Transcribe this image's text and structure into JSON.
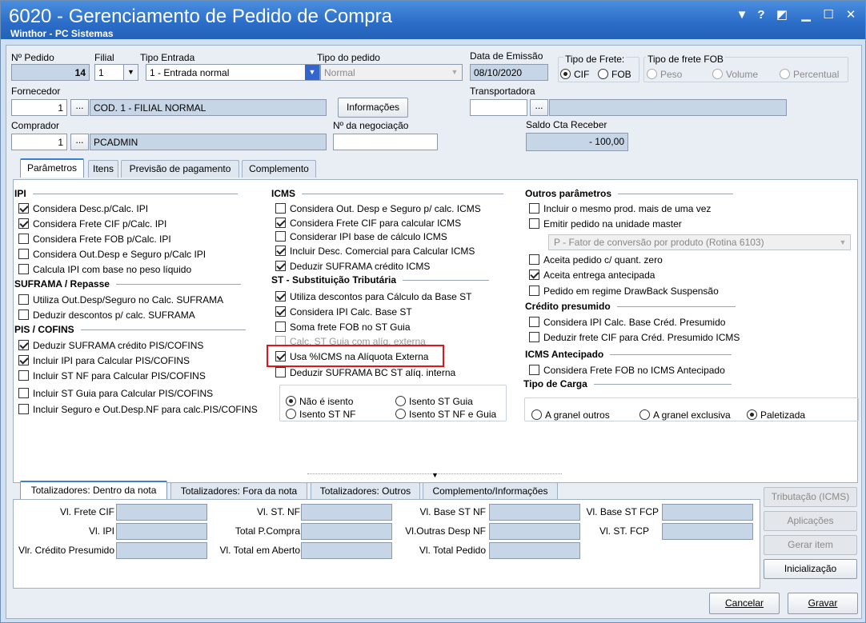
{
  "window": {
    "title": "6020 - Gerenciamento de Pedido de Compra",
    "subtitle": "Winthor - PC Sistemas",
    "buttons": {
      "menu": "▼",
      "help": "?",
      "restore": "◩",
      "minimize": "▁",
      "maximize": "☐",
      "close": "✕"
    }
  },
  "header": {
    "nro_pedido": {
      "label": "Nº Pedido",
      "value": "14"
    },
    "filial": {
      "label": "Filial",
      "value": "1"
    },
    "tipo_entrada": {
      "label": "Tipo Entrada",
      "value": "1 - Entrada normal"
    },
    "tipo_pedido": {
      "label": "Tipo do pedido",
      "value": "Normal"
    },
    "data_emissao": {
      "label": "Data de Emissão",
      "value": "08/10/2020"
    },
    "tipo_frete": {
      "label": "Tipo de Frete:",
      "options": [
        "CIF",
        "FOB"
      ],
      "selected": "CIF"
    },
    "tipo_frete_fob": {
      "label": "Tipo de frete FOB",
      "options": [
        "Peso",
        "Volume",
        "Percentual"
      ]
    },
    "fornecedor": {
      "label": "Fornecedor",
      "code": "1",
      "name": "COD. 1 - FILIAL NORMAL"
    },
    "informacoes_button": "Informações",
    "transportadora": {
      "label": "Transportadora",
      "code": "",
      "name": ""
    },
    "comprador": {
      "label": "Comprador",
      "code": "1",
      "name": "PCADMIN"
    },
    "nro_negociacao": {
      "label": "Nº da negociação",
      "value": ""
    },
    "saldo_cta": {
      "label": "Saldo Cta Receber",
      "value": "- 100,00"
    },
    "ellipsis": "..."
  },
  "tabs": [
    "Parâmetros",
    "Itens",
    "Previsão de pagamento",
    "Complemento"
  ],
  "params": {
    "ipi": {
      "title": "IPI",
      "items": [
        {
          "label": "Considera Desc.p/Calc. IPI",
          "checked": true
        },
        {
          "label": "Considera Frete CIF p/Calc. IPI",
          "checked": true
        },
        {
          "label": "Considera Frete FOB p/Calc. IPI",
          "checked": false
        },
        {
          "label": "Considera Out.Desp e Seguro p/Calc IPI",
          "checked": false
        },
        {
          "label": "Calcula IPI com base no peso líquido",
          "checked": false
        }
      ]
    },
    "suframa": {
      "title": "SUFRAMA / Repasse",
      "items": [
        {
          "label": "Utiliza Out.Desp/Seguro no Calc. SUFRAMA",
          "checked": false
        },
        {
          "label": "Deduzir descontos p/ calc. SUFRAMA",
          "checked": false
        }
      ]
    },
    "pis": {
      "title": "PIS / COFINS",
      "items": [
        {
          "label": "Deduzir SUFRAMA crédito PIS/COFINS",
          "checked": true
        },
        {
          "label": "Incluir IPI para Calcular PIS/COFINS",
          "checked": true
        },
        {
          "label": "Incluir ST NF para Calcular PIS/COFINS",
          "checked": false
        },
        {
          "label": "Incluir ST Guia para Calcular PIS/COFINS",
          "checked": false
        },
        {
          "label": "Incluir Seguro e Out.Desp.NF para calc.PIS/COFINS",
          "checked": false
        }
      ]
    },
    "icms": {
      "title": "ICMS",
      "items": [
        {
          "label": "Considera Out. Desp e Seguro p/ calc. ICMS",
          "checked": false
        },
        {
          "label": "Considera Frete CIF para calcular ICMS",
          "checked": true
        },
        {
          "label": "Considerar IPI base de cálculo ICMS",
          "checked": false
        },
        {
          "label": "Incluir Desc. Comercial  para Calcular ICMS",
          "checked": true
        },
        {
          "label": "Deduzir SUFRAMA crédito ICMS",
          "checked": true
        }
      ]
    },
    "st": {
      "title": "ST - Substituição Tributária",
      "items": [
        {
          "label": "Utiliza descontos para Cálculo da Base ST",
          "checked": true
        },
        {
          "label": "Considera IPI Calc. Base ST",
          "checked": true
        },
        {
          "label": "Soma frete FOB no ST Guia",
          "checked": false
        },
        {
          "label": "Calc. ST Guia com alíq. externa",
          "checked": false,
          "disabled": true
        },
        {
          "label": "Usa %ICMS na Alíquota Externa",
          "checked": true
        },
        {
          "label": "Deduzir SUFRAMA BC ST alíq. interna",
          "checked": false
        }
      ]
    },
    "isencao": {
      "options": [
        "Não é isento",
        "Isento ST Guia",
        "Isento ST NF",
        "Isento ST NF e Guia"
      ],
      "selected": "Não é isento"
    },
    "outros": {
      "title": "Outros parâmetros",
      "items": [
        {
          "label": "Incluir o mesmo prod. mais de uma vez",
          "checked": false
        },
        {
          "label": "Emitir pedido na unidade master",
          "checked": false
        },
        {
          "label": "Aceita pedido c/ quant. zero",
          "checked": false
        },
        {
          "label": "Aceita entrega antecipada",
          "checked": true
        },
        {
          "label": "Pedido em regime DrawBack Suspensão",
          "checked": false
        }
      ],
      "fator": "P - Fator de conversão por produto (Rotina 6103)"
    },
    "credito": {
      "title": "Crédito presumido",
      "items": [
        {
          "label": "Considera IPI Calc. Base Créd. Presumido",
          "checked": false
        },
        {
          "label": "Deduzir frete CIF para Créd. Presumido ICMS",
          "checked": false
        }
      ]
    },
    "antecipado": {
      "title": "ICMS Antecipado",
      "items": [
        {
          "label": "Considera Frete FOB no ICMS Antecipado",
          "checked": false
        }
      ]
    },
    "carga": {
      "title": "Tipo de Carga",
      "options": [
        "A granel outros",
        "A granel exclusiva",
        "Paletizada"
      ],
      "selected": "Paletizada"
    }
  },
  "bottom_tabs": [
    "Totalizadores: Dentro da nota",
    "Totalizadores: Fora da nota",
    "Totalizadores: Outros",
    "Complemento/Informações"
  ],
  "totals": {
    "vl_frete_cif": "Vl. Frete CIF",
    "vl_ipi": "Vl. IPI",
    "vl_credito_presumido": "Vlr. Crédito Presumido",
    "vl_st_nf": "Vl. ST. NF",
    "total_pcompra": "Total P.Compra",
    "vl_total_aberto": "Vl. Total em Aberto",
    "vl_base_st_nf": "Vl. Base ST NF",
    "vl_outras_desp_nf": "Vl.Outras Desp NF",
    "vl_total_pedido": "Vl. Total  Pedido",
    "vl_base_st_fcp": "Vl. Base ST FCP",
    "vl_st_fcp": "Vl. ST. FCP"
  },
  "side_buttons": {
    "tributacao": "Tributação (ICMS)",
    "aplicacoes": "Aplicações",
    "gerar_item": "Gerar item",
    "inicializacao": "Inicialização"
  },
  "footer": {
    "cancelar": "Cancelar",
    "gravar": "Gravar"
  }
}
